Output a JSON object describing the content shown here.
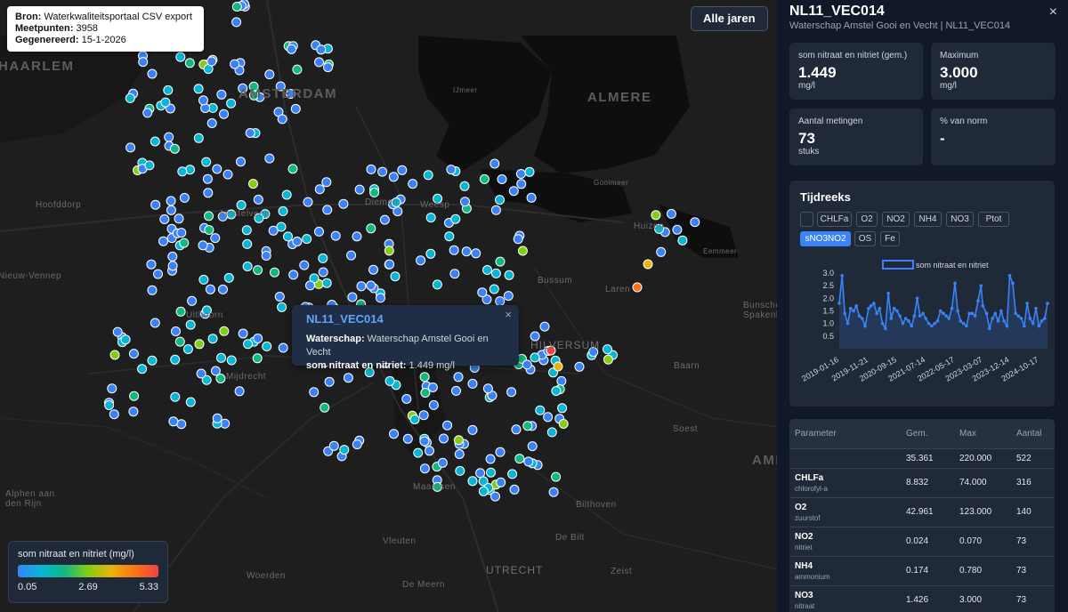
{
  "map": {
    "info": {
      "source_label": "Bron:",
      "source_value": "Waterkwaliteitsportaal CSV export",
      "points_label": "Meetpunten:",
      "points_value": "3958",
      "generated_label": "Gegenereerd:",
      "generated_value": "15-1-2026"
    },
    "year_button": "Alle jaren",
    "places": {
      "haarlem": "HAARLEM",
      "amsterdam": "AMSTERDAM",
      "almere": "ALMERE",
      "hoofddorp": "Hoofddorp",
      "amstelveen": "Amstelveen",
      "diemen": "Diemen",
      "weesp": "Weesp",
      "uithoorn": "Uithoorn",
      "mijdrecht": "Mijdrecht",
      "hilversum": "HILVERSUM",
      "huizen": "Huizen",
      "laren": "Laren",
      "bussum": "Bussum",
      "baarn": "Baarn",
      "soest": "Soest",
      "bilthoven": "Bilthoven",
      "debilt": "De Bilt",
      "zeist": "Zeist",
      "utrecht": "UTRECHT",
      "maarssen": "Maarssen",
      "alphen": "Alphen aan den Rijn",
      "woerden": "Woerden",
      "demeern": "De Meern",
      "vleuten": "Vleuten",
      "nieuwvennep": "Nieuw-Vennep",
      "bunschoten": "Bunschoten-Spakenburg",
      "ijmeer": "IJmeer",
      "gooimeer": "Gooimeer",
      "eemmeer": "Eemmeer",
      "amer": "AMER",
      "haarlem_r": "HAARLEM"
    },
    "popup": {
      "title": "NL11_VEC014",
      "ws_label": "Waterschap:",
      "ws_value": "Waterschap Amstel Gooi en Vecht",
      "p_label": "som nitraat en nitriet:",
      "p_value": "1.449 mg/l",
      "close": "×"
    },
    "legend": {
      "title": "som nitraat en nitriet (mg/l)",
      "min": "0.05",
      "mid": "2.69",
      "max": "5.33",
      "colors": [
        "#3b82f6",
        "#06b6d4",
        "#10b981",
        "#84cc16",
        "#eab308",
        "#f97316",
        "#ef4444"
      ]
    }
  },
  "sidebar": {
    "title": "NL11_VEC014",
    "subtitle": "Waterschap Amstel Gooi en Vecht | NL11_VEC014",
    "close": "×",
    "stats": [
      {
        "label": "som nitraat en nitriet (gem.)",
        "value": "1.449",
        "unit": "mg/l"
      },
      {
        "label": "Maximum",
        "value": "3.000",
        "unit": "mg/l"
      },
      {
        "label": "Aantal metingen",
        "value": "73",
        "unit": "stuks"
      },
      {
        "label": "% van norm",
        "value": "-",
        "unit": ""
      }
    ],
    "timeseries": {
      "title": "Tijdreeks",
      "chips": [
        "",
        "CHLFa",
        "O2",
        "NO2",
        "NH4",
        "NO3",
        "Ptot",
        "sNO3NO2",
        "OS",
        "Fe"
      ],
      "active_chip": "sNO3NO2"
    },
    "table": {
      "headers": [
        "Parameter",
        "Gem.",
        "Max",
        "Aantal"
      ],
      "rows": [
        {
          "name": "",
          "sub": "",
          "avg": "35.361",
          "max": "220.000",
          "count": "522"
        },
        {
          "name": "CHLFa",
          "sub": "chlorofyl-a",
          "avg": "8.832",
          "max": "74.000",
          "count": "316"
        },
        {
          "name": "O2",
          "sub": "zuurstof",
          "avg": "42.961",
          "max": "123.000",
          "count": "140"
        },
        {
          "name": "NO2",
          "sub": "nitriet",
          "avg": "0.024",
          "max": "0.070",
          "count": "73"
        },
        {
          "name": "NH4",
          "sub": "ammonium",
          "avg": "0.174",
          "max": "0.780",
          "count": "73"
        },
        {
          "name": "NO3",
          "sub": "nitraat",
          "avg": "1.426",
          "max": "3.000",
          "count": "73"
        }
      ]
    }
  },
  "chart_data": {
    "type": "line",
    "legend": "som nitraat en nitriet",
    "legend_position": "top",
    "color": "#3b82f6",
    "ylim": [
      0,
      3.0
    ],
    "yticks": [
      "0.5",
      "1.0",
      "1.5",
      "2.0",
      "2.5",
      "3.0"
    ],
    "xticks": [
      "2019-01-16",
      "2019-11-21",
      "2020-09-15",
      "2021-07-14",
      "2022-05-17",
      "2023-03-07",
      "2023-12-14",
      "2024-10-17"
    ],
    "x": [
      "2019-01-16",
      "2019-02-15",
      "2019-03-15",
      "2019-04-15",
      "2019-05-15",
      "2019-06-15",
      "2019-07-15",
      "2019-08-15",
      "2019-09-15",
      "2019-10-15",
      "2019-11-21",
      "2019-12-15",
      "2020-01-15",
      "2020-02-15",
      "2020-03-15",
      "2020-04-15",
      "2020-05-15",
      "2020-06-15",
      "2020-07-15",
      "2020-08-15",
      "2020-09-15",
      "2020-10-15",
      "2020-11-15",
      "2020-12-15",
      "2021-01-15",
      "2021-02-15",
      "2021-03-15",
      "2021-04-15",
      "2021-05-15",
      "2021-06-15",
      "2021-07-14",
      "2021-08-15",
      "2021-09-15",
      "2021-10-15",
      "2021-11-15",
      "2021-12-15",
      "2022-01-15",
      "2022-02-15",
      "2022-03-15",
      "2022-04-15",
      "2022-05-17",
      "2022-06-15",
      "2022-07-15",
      "2022-08-15",
      "2022-09-15",
      "2022-10-15",
      "2022-11-15",
      "2022-12-15",
      "2023-01-15",
      "2023-02-15",
      "2023-03-07",
      "2023-04-15",
      "2023-05-15",
      "2023-06-15",
      "2023-07-15",
      "2023-08-15",
      "2023-09-15",
      "2023-10-15",
      "2023-11-15",
      "2023-12-14",
      "2024-01-15",
      "2024-02-15",
      "2024-03-15",
      "2024-04-15",
      "2024-05-15",
      "2024-06-15",
      "2024-07-15",
      "2024-08-15",
      "2024-09-15",
      "2024-10-17",
      "2024-11-15",
      "2024-12-15",
      "2025-01-15"
    ],
    "values": [
      1.8,
      2.9,
      1.4,
      1.0,
      1.6,
      1.5,
      1.7,
      1.3,
      1.2,
      0.9,
      1.6,
      1.7,
      1.8,
      1.4,
      1.6,
      1.0,
      0.8,
      2.2,
      1.2,
      1.6,
      1.5,
      1.3,
      1.0,
      1.2,
      1.1,
      0.9,
      1.3,
      2.0,
      1.3,
      1.4,
      1.2,
      1.0,
      0.9,
      1.0,
      1.1,
      1.5,
      1.4,
      1.3,
      1.2,
      1.6,
      2.6,
      1.5,
      1.1,
      1.0,
      0.9,
      1.4,
      1.4,
      1.3,
      1.9,
      2.5,
      1.7,
      1.4,
      0.8,
      1.2,
      1.4,
      1.1,
      1.5,
      1.1,
      0.9,
      2.9,
      2.6,
      1.4,
      1.3,
      1.2,
      0.9,
      1.8,
      1.2,
      1.0,
      1.6,
      0.9,
      1.1,
      1.2,
      1.8
    ]
  }
}
